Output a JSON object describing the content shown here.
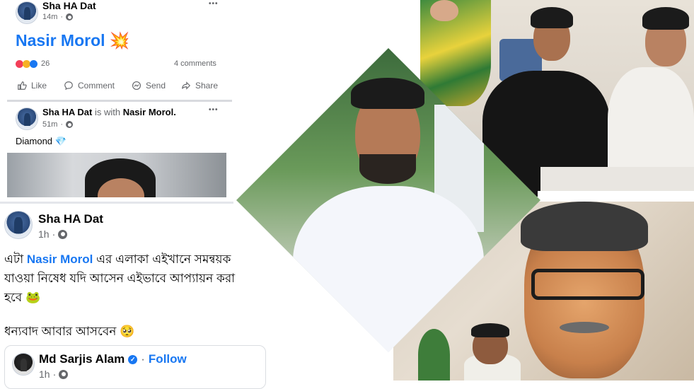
{
  "post1": {
    "author": "Sha HA Dat",
    "time": "14m",
    "more": "•••",
    "title": "Nasir Morol",
    "title_emoji": "💥",
    "reactions_count": "26",
    "comments": "4 comments",
    "actions": {
      "like": "Like",
      "comment": "Comment",
      "send": "Send",
      "share": "Share"
    }
  },
  "post2": {
    "author": "Sha HA Dat",
    "with_text": "is with",
    "tagged": "Nasir Morol.",
    "time": "51m",
    "more": "•••",
    "text": "Diamond",
    "emoji": "💎"
  },
  "post3": {
    "author": "Sha HA Dat",
    "time": "1h",
    "line1_a": "এটা",
    "line1_link": "Nasir Morol",
    "line1_b": "এর এলাকা এইখানে সমন্বয়ক",
    "line2": "যাওয়া নিষেধ যদি আসেন এইভাবে আপ্যায়ন করা",
    "line3": "হবে",
    "line3_emoji": "🐸",
    "line4": "ধন্যবাদ আবার আসবেন",
    "line4_emoji": "🥺"
  },
  "post4": {
    "author": "Md Sarjis Alam",
    "sep": "·",
    "follow": "Follow",
    "time": "1h"
  },
  "colors": {
    "link": "#1877f2",
    "title": "#1877f2",
    "text": "#050505",
    "secondary": "#65676b"
  },
  "icons": [
    "globe-icon",
    "more-icon",
    "like-icon",
    "comment-icon",
    "send-icon",
    "share-icon",
    "verified-icon"
  ]
}
